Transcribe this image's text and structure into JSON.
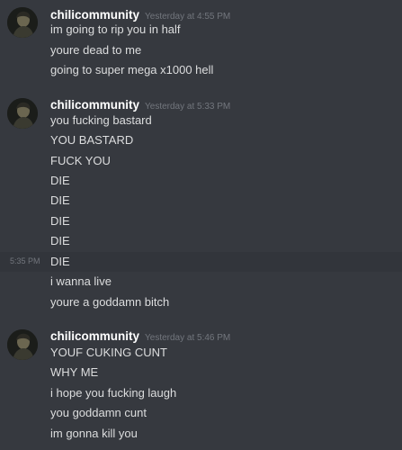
{
  "colors": {
    "background": "#36393f",
    "hover_background": "#32353b",
    "username": "#ffffff",
    "timestamp": "#72767d",
    "message_text": "#dcddde"
  },
  "groups": [
    {
      "username": "chilicommunity",
      "timestamp": "Yesterday at 4:55 PM",
      "avatar_icon": "user-avatar-icon",
      "messages": [
        "im going to rip you in half",
        "youre dead to me",
        "going to super mega x1000 hell"
      ]
    },
    {
      "username": "chilicommunity",
      "timestamp": "Yesterday at 5:33 PM",
      "avatar_icon": "user-avatar-icon",
      "messages": [
        "you fucking bastard",
        "YOU BASTARD",
        "FUCK YOU",
        "DIE",
        "DIE",
        "DIE",
        "DIE",
        "DIE",
        "i wanna live",
        "youre a goddamn bitch"
      ],
      "hover_line_side_time": "5:35 PM"
    },
    {
      "username": "chilicommunity",
      "timestamp": "Yesterday at 5:46 PM",
      "avatar_icon": "user-avatar-icon",
      "messages": [
        "YOUF CUKING CUNT",
        "WHY ME",
        "i hope you fucking laugh",
        "you goddamn cunt",
        "im gonna kill you"
      ]
    }
  ]
}
